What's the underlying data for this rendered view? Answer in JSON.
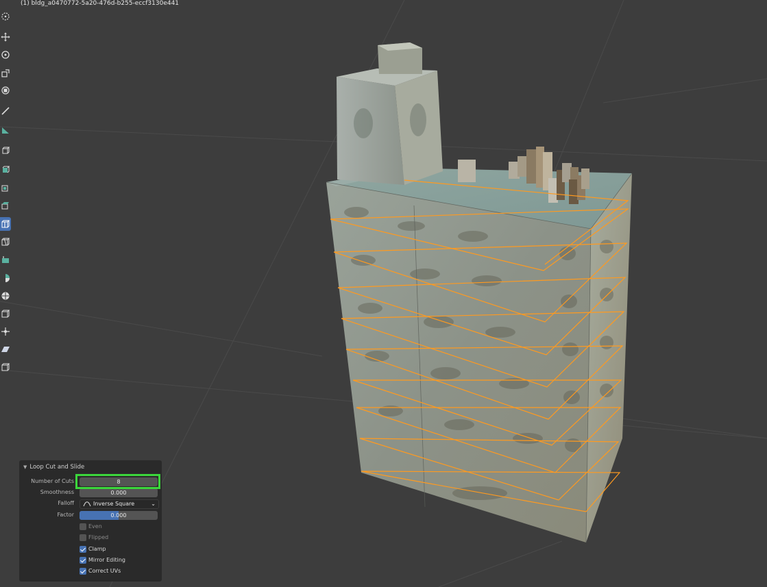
{
  "viewport": {
    "object_name": "(1) bldg_a0470772-5a20-476d-b255-eccf3130e441"
  },
  "toolbar": {
    "tools": [
      {
        "name": "cursor-tool-icon"
      },
      {
        "name": "move-tool-icon"
      },
      {
        "name": "rotate-tool-icon"
      },
      {
        "name": "scale-tool-icon"
      },
      {
        "name": "transform-tool-icon"
      },
      {
        "name": "annotate-tool-icon"
      },
      {
        "name": "measure-tool-icon"
      },
      {
        "name": "add-cube-tool-icon"
      },
      {
        "name": "extrude-region-tool-icon"
      },
      {
        "name": "inset-faces-tool-icon"
      },
      {
        "name": "bevel-tool-icon"
      },
      {
        "name": "loop-cut-tool-icon"
      },
      {
        "name": "knife-tool-icon"
      },
      {
        "name": "poly-build-tool-icon"
      },
      {
        "name": "spin-tool-icon"
      },
      {
        "name": "smooth-tool-icon"
      },
      {
        "name": "edge-slide-tool-icon"
      },
      {
        "name": "shrink-fatten-tool-icon"
      },
      {
        "name": "shear-tool-icon"
      },
      {
        "name": "rip-region-tool-icon"
      }
    ],
    "active_tool": "loop-cut-tool-icon"
  },
  "operator_panel": {
    "title": "Loop Cut and Slide",
    "number_of_cuts": {
      "label": "Number of Cuts",
      "value": "8"
    },
    "smoothness": {
      "label": "Smoothness",
      "value": "0.000"
    },
    "falloff": {
      "label": "Falloff",
      "value": "Inverse Square"
    },
    "factor": {
      "label": "Factor",
      "value": "0.000",
      "fill_fraction": 0.5
    },
    "checkboxes": [
      {
        "label": "Even",
        "checked": false
      },
      {
        "label": "Flipped",
        "checked": false
      },
      {
        "label": "Clamp",
        "checked": true
      },
      {
        "label": "Mirror Editing",
        "checked": true
      },
      {
        "label": "Correct UVs",
        "checked": true
      }
    ]
  },
  "colors": {
    "viewport_bg": "#3d3d3d",
    "accent_blue": "#4772b3",
    "loop_cut_orange": "#ff9a1f",
    "highlight_green": "#3bd63b"
  }
}
